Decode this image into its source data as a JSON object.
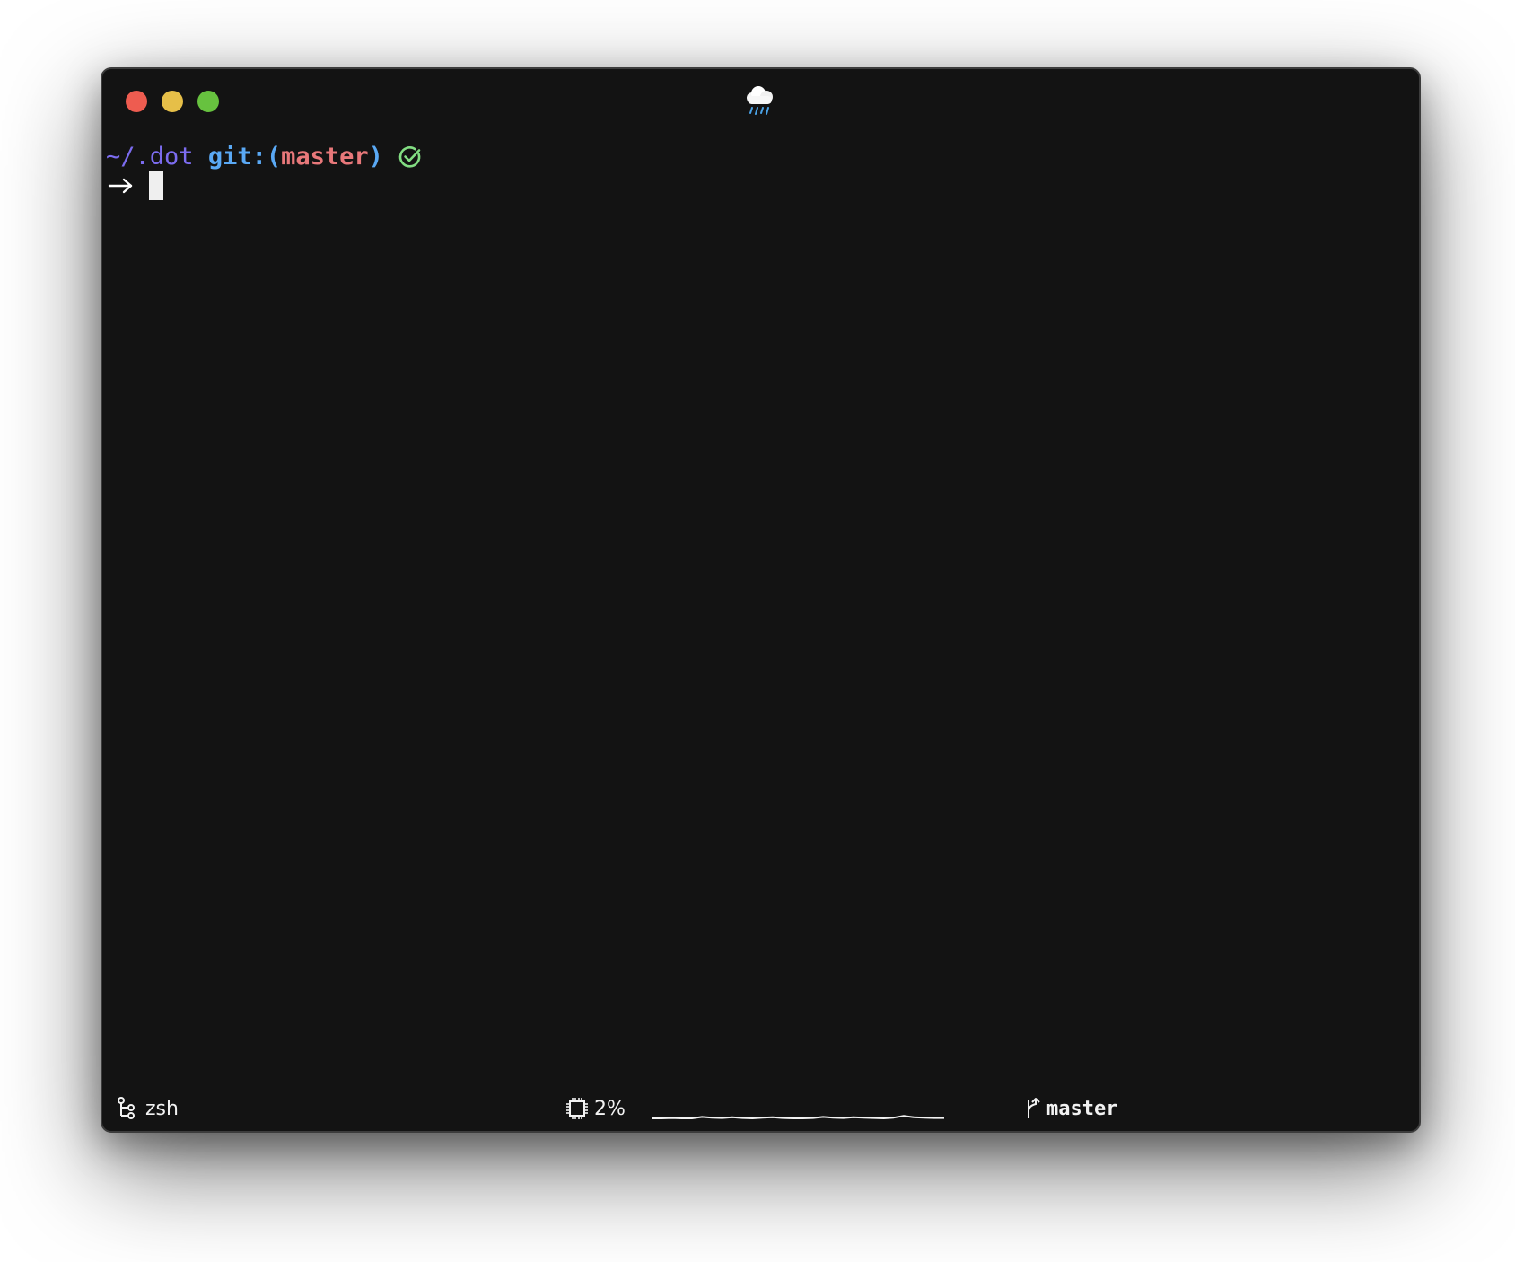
{
  "window": {
    "titlebar_icon": "cloud-rain-icon",
    "traffic_lights": {
      "close": "#ee5c50",
      "minimize": "#e6bf48",
      "maximize": "#67c23f"
    }
  },
  "prompt": {
    "path": "~/.dot",
    "git_prefix": "git:(",
    "branch": "master",
    "git_suffix": ")",
    "status_icon": "check-circle-icon",
    "arrow": "→",
    "colors": {
      "path": "#7c6cf0",
      "git": "#5aa9f5",
      "branch": "#e8787a",
      "check": "#82dd82",
      "text": "#ffffff"
    }
  },
  "statusbar": {
    "shell_icon": "process-tree-icon",
    "shell_name": "zsh",
    "cpu_icon": "cpu-chip-icon",
    "cpu_percent": "2%",
    "cpu_history": [
      0.05,
      0.05,
      0.06,
      0.05,
      0.05,
      0.09,
      0.07,
      0.06,
      0.08,
      0.06,
      0.05,
      0.07,
      0.08,
      0.06,
      0.05,
      0.05,
      0.06,
      0.09,
      0.07,
      0.06,
      0.08,
      0.07,
      0.06,
      0.05,
      0.07,
      0.12,
      0.08,
      0.07,
      0.06,
      0.06
    ],
    "branch_icon": "git-branch-icon",
    "branch_name": "master"
  }
}
